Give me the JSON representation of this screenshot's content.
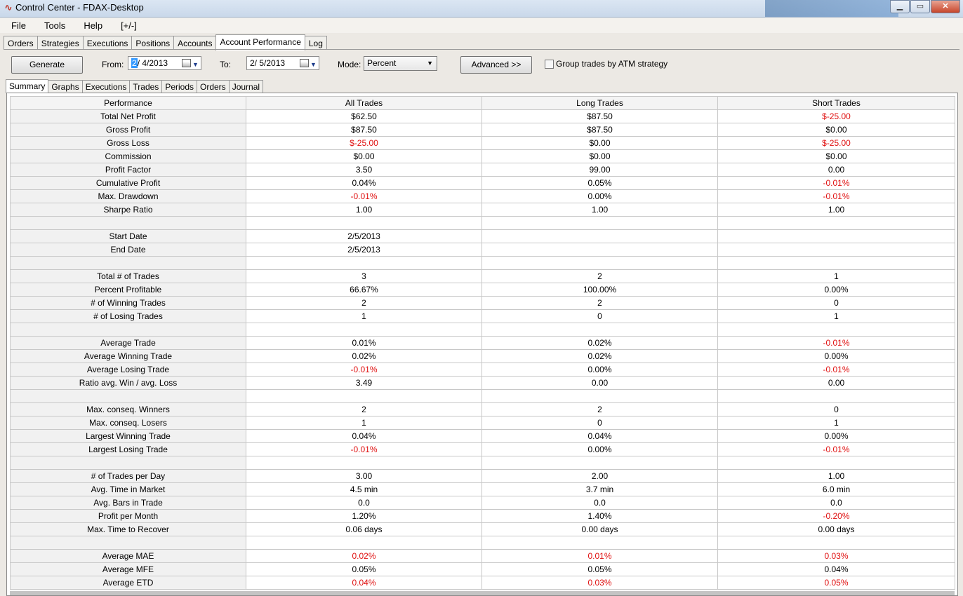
{
  "window": {
    "title": "Control Center - FDAX-Desktop"
  },
  "menu": [
    "File",
    "Tools",
    "Help",
    "[+/-]"
  ],
  "main_tabs": [
    {
      "label": "Orders",
      "active": false
    },
    {
      "label": "Strategies",
      "active": false
    },
    {
      "label": "Executions",
      "active": false
    },
    {
      "label": "Positions",
      "active": false
    },
    {
      "label": "Accounts",
      "active": false
    },
    {
      "label": "Account Performance",
      "active": true
    },
    {
      "label": "Log",
      "active": false
    }
  ],
  "toolbar": {
    "generate_label": "Generate",
    "from_label": "From:",
    "from_month": "2",
    "from_rest": "/ 4/2013",
    "to_label": "To:",
    "to_value": "2/ 5/2013",
    "mode_label": "Mode:",
    "mode_value": "Percent",
    "advanced_label": "Advanced >>",
    "group_label": "Group trades by ATM strategy",
    "group_checked": false
  },
  "sub_tabs": [
    {
      "label": "Summary",
      "active": true
    },
    {
      "label": "Graphs",
      "active": false
    },
    {
      "label": "Executions",
      "active": false
    },
    {
      "label": "Trades",
      "active": false
    },
    {
      "label": "Periods",
      "active": false
    },
    {
      "label": "Orders",
      "active": false
    },
    {
      "label": "Journal",
      "active": false
    }
  ],
  "colors": {
    "negative": "#e01010",
    "selection": "#3399ff"
  },
  "table": {
    "headers": [
      "Performance",
      "All Trades",
      "Long Trades",
      "Short Trades"
    ],
    "rows": [
      [
        "Total Net Profit",
        "$62.50",
        "$87.50",
        "$-25.00"
      ],
      [
        "Gross Profit",
        "$87.50",
        "$87.50",
        "$0.00"
      ],
      [
        "Gross Loss",
        "$-25.00",
        "$0.00",
        "$-25.00"
      ],
      [
        "Commission",
        "$0.00",
        "$0.00",
        "$0.00"
      ],
      [
        "Profit Factor",
        "3.50",
        "99.00",
        "0.00"
      ],
      [
        "Cumulative Profit",
        "0.04%",
        "0.05%",
        "-0.01%"
      ],
      [
        "Max. Drawdown",
        "-0.01%",
        "0.00%",
        "-0.01%"
      ],
      [
        "Sharpe Ratio",
        "1.00",
        "1.00",
        "1.00"
      ],
      [
        "",
        "",
        "",
        ""
      ],
      [
        "Start Date",
        "2/5/2013",
        "",
        ""
      ],
      [
        "End Date",
        "2/5/2013",
        "",
        ""
      ],
      [
        "",
        "",
        "",
        ""
      ],
      [
        "Total # of Trades",
        "3",
        "2",
        "1"
      ],
      [
        "Percent Profitable",
        "66.67%",
        "100.00%",
        "0.00%"
      ],
      [
        "# of Winning Trades",
        "2",
        "2",
        "0"
      ],
      [
        "# of Losing Trades",
        "1",
        "0",
        "1"
      ],
      [
        "",
        "",
        "",
        ""
      ],
      [
        "Average Trade",
        "0.01%",
        "0.02%",
        "-0.01%"
      ],
      [
        "Average Winning Trade",
        "0.02%",
        "0.02%",
        "0.00%"
      ],
      [
        "Average Losing Trade",
        "-0.01%",
        "0.00%",
        "-0.01%"
      ],
      [
        "Ratio avg. Win / avg. Loss",
        "3.49",
        "0.00",
        "0.00"
      ],
      [
        "",
        "",
        "",
        ""
      ],
      [
        "Max. conseq. Winners",
        "2",
        "2",
        "0"
      ],
      [
        "Max. conseq. Losers",
        "1",
        "0",
        "1"
      ],
      [
        "Largest Winning Trade",
        "0.04%",
        "0.04%",
        "0.00%"
      ],
      [
        "Largest Losing Trade",
        "-0.01%",
        "0.00%",
        "-0.01%"
      ],
      [
        "",
        "",
        "",
        ""
      ],
      [
        "# of Trades per Day",
        "3.00",
        "2.00",
        "1.00"
      ],
      [
        "Avg. Time in Market",
        "4.5 min",
        "3.7 min",
        "6.0 min"
      ],
      [
        "Avg. Bars in Trade",
        "0.0",
        "0.0",
        "0.0"
      ],
      [
        "Profit per Month",
        "1.20%",
        "1.40%",
        "-0.20%"
      ],
      [
        "Max. Time to Recover",
        "0.06 days",
        "0.00 days",
        "0.00 days"
      ],
      [
        "",
        "",
        "",
        ""
      ],
      [
        "Average MAE",
        "0.02%",
        "0.01%",
        "0.03%"
      ],
      [
        "Average MFE",
        "0.05%",
        "0.05%",
        "0.04%"
      ],
      [
        "Average ETD",
        "0.04%",
        "0.03%",
        "0.05%"
      ]
    ],
    "red_cells": [
      [
        0,
        3
      ],
      [
        2,
        1
      ],
      [
        2,
        3
      ],
      [
        5,
        3
      ],
      [
        6,
        1
      ],
      [
        6,
        3
      ],
      [
        17,
        3
      ],
      [
        19,
        1
      ],
      [
        19,
        3
      ],
      [
        25,
        1
      ],
      [
        25,
        3
      ],
      [
        30,
        3
      ],
      [
        33,
        1
      ],
      [
        33,
        2
      ],
      [
        33,
        3
      ],
      [
        35,
        1
      ],
      [
        35,
        2
      ],
      [
        35,
        3
      ]
    ]
  }
}
